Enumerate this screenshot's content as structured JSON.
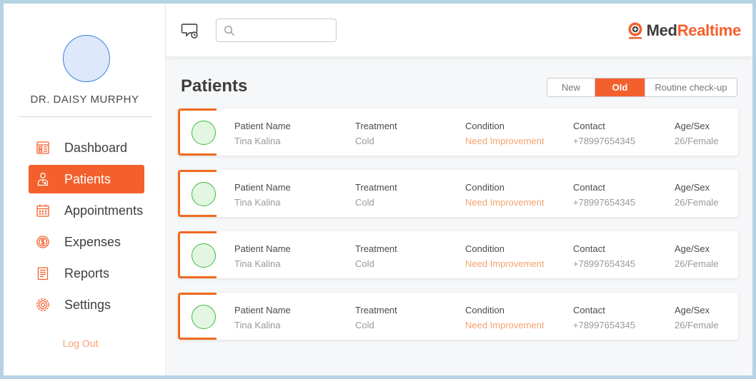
{
  "colors": {
    "accent": "#f4602d",
    "condition": "#f6a26e",
    "avatar_green": "#3dbb3d",
    "profile_blue": "#3a82e0"
  },
  "sidebar": {
    "doctor_name": "DR. DAISY MURPHY",
    "items": [
      {
        "label": "Dashboard",
        "icon": "dashboard-icon"
      },
      {
        "label": "Patients",
        "icon": "patient-icon",
        "active": true
      },
      {
        "label": "Appointments",
        "icon": "calendar-icon"
      },
      {
        "label": "Expenses",
        "icon": "dollar-icon"
      },
      {
        "label": "Reports",
        "icon": "report-icon"
      },
      {
        "label": "Settings",
        "icon": "gear-icon"
      }
    ],
    "logout": "Log Out"
  },
  "header": {
    "search_placeholder": "",
    "logo": {
      "part1": "Med",
      "part2": "Realtime"
    }
  },
  "main": {
    "title": "Patients",
    "filters": [
      {
        "label": "New"
      },
      {
        "label": "Old",
        "active": true
      },
      {
        "label": "Routine check-up"
      }
    ],
    "columns": {
      "name": "Patient Name",
      "treatment": "Treatment",
      "condition": "Condition",
      "contact": "Contact",
      "age_sex": "Age/Sex"
    },
    "patients": [
      {
        "name": "Tina Kalina",
        "treatment": "Cold",
        "condition": "Need Improvement",
        "contact": "+78997654345",
        "age_sex": "26/Female"
      },
      {
        "name": "Tina Kalina",
        "treatment": "Cold",
        "condition": "Need Improvement",
        "contact": "+78997654345",
        "age_sex": "26/Female"
      },
      {
        "name": "Tina Kalina",
        "treatment": "Cold",
        "condition": "Need Improvement",
        "contact": "+78997654345",
        "age_sex": "26/Female"
      },
      {
        "name": "Tina Kalina",
        "treatment": "Cold",
        "condition": "Need Improvement",
        "contact": "+78997654345",
        "age_sex": "26/Female"
      }
    ]
  }
}
